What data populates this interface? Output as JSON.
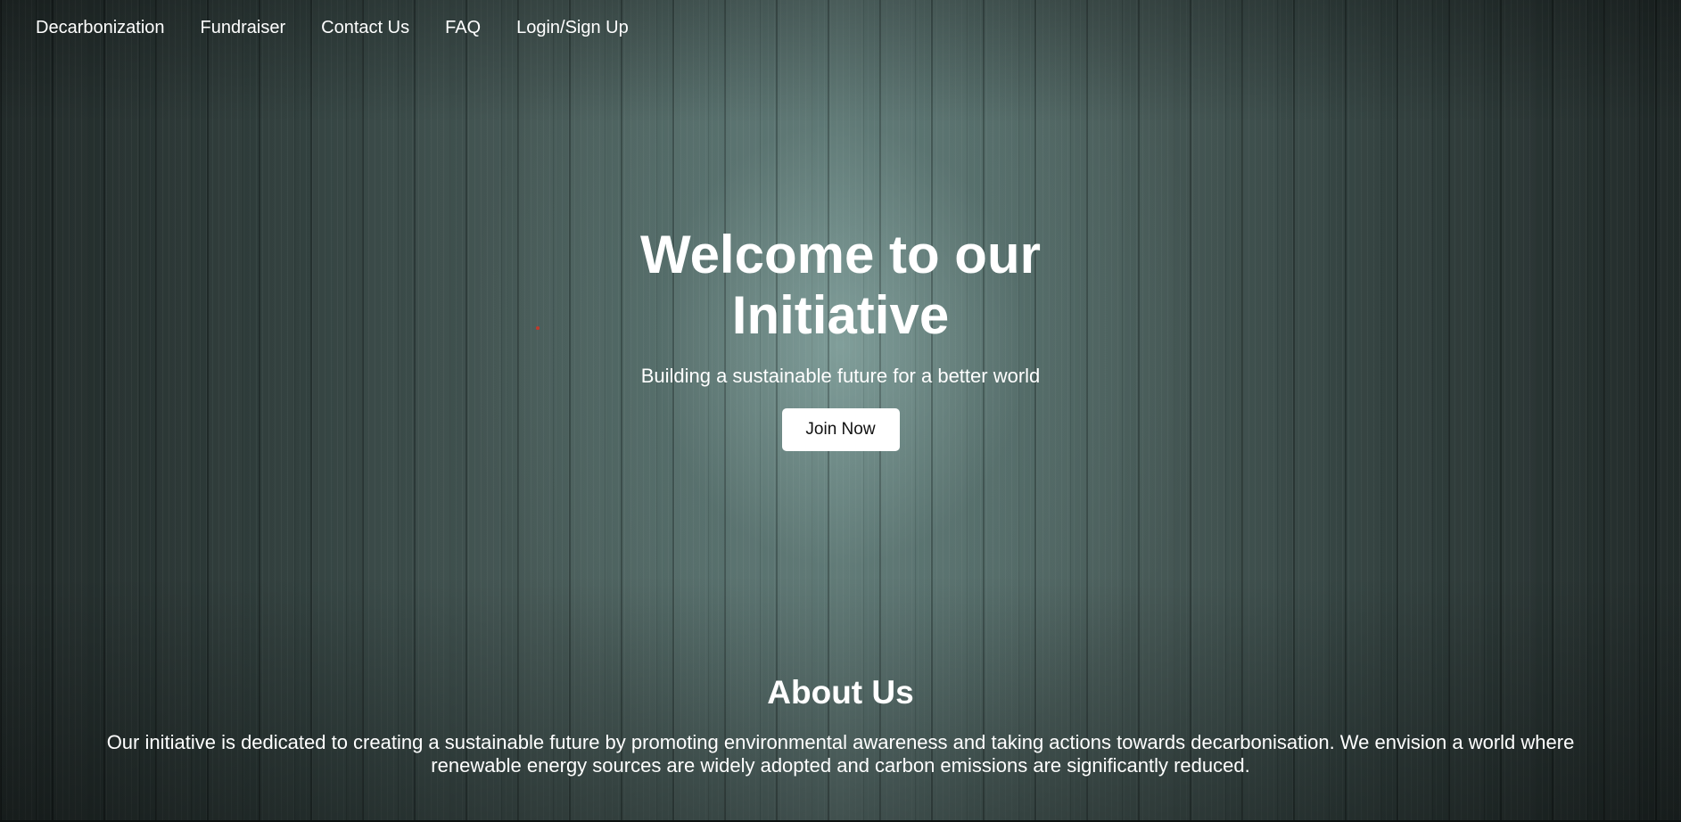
{
  "nav": {
    "items": [
      {
        "label": "Decarbonization"
      },
      {
        "label": "Fundraiser"
      },
      {
        "label": "Contact Us"
      },
      {
        "label": "FAQ"
      },
      {
        "label": "Login/Sign Up"
      }
    ]
  },
  "hero": {
    "title": "Welcome to our Initiative",
    "subtitle": "Building a sustainable future for a better world",
    "cta_label": "Join Now"
  },
  "about": {
    "heading": "About Us",
    "text": "Our initiative is dedicated to creating a sustainable future by promoting environmental awareness and taking actions towards decarbonisation. We envision a world where renewable energy sources are widely adopted and carbon emissions are significantly reduced."
  },
  "colors": {
    "background": "#4a5f5c",
    "text": "#ffffff",
    "button_bg": "#ffffff",
    "button_text": "#111111"
  }
}
